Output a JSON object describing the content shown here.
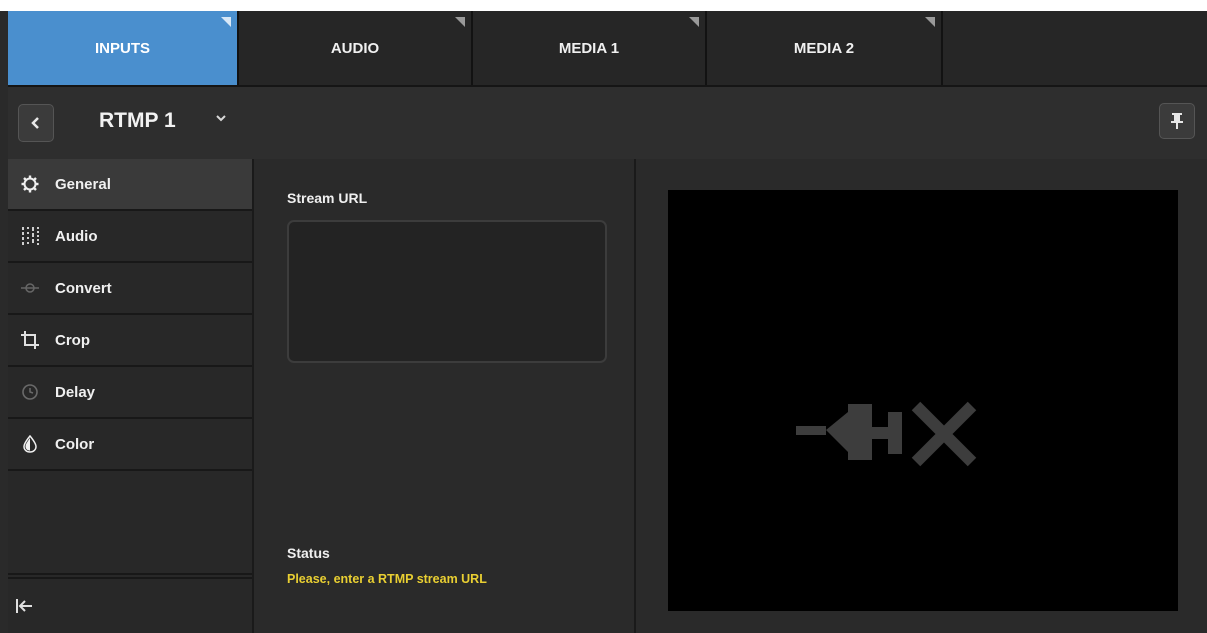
{
  "tabs": [
    {
      "label": "INPUTS",
      "active": true
    },
    {
      "label": "AUDIO",
      "active": false
    },
    {
      "label": "MEDIA 1",
      "active": false
    },
    {
      "label": "MEDIA 2",
      "active": false
    }
  ],
  "header": {
    "back_icon": "chevron-left-icon",
    "title": "RTMP 1",
    "dropdown_icon": "chevron-down-icon",
    "pin_icon": "pin-icon"
  },
  "sidebar": {
    "items": [
      {
        "label": "General",
        "icon": "gear-icon",
        "active": true
      },
      {
        "label": "Audio",
        "icon": "sliders-icon",
        "active": false
      },
      {
        "label": "Convert",
        "icon": "convert-icon",
        "active": false
      },
      {
        "label": "Crop",
        "icon": "crop-icon",
        "active": false
      },
      {
        "label": "Delay",
        "icon": "clock-icon",
        "active": false
      },
      {
        "label": "Color",
        "icon": "drop-icon",
        "active": false
      }
    ],
    "collapse_icon": "collapse-left-icon"
  },
  "main": {
    "stream_url_label": "Stream URL",
    "stream_url_value": "",
    "status_label": "Status",
    "status_message": "Please, enter a RTMP stream URL"
  },
  "preview": {
    "icon": "disconnected-plug-icon"
  },
  "colors": {
    "accent": "#4a8fce",
    "status_warning": "#e9cf32",
    "background": "#2a2a2a"
  }
}
